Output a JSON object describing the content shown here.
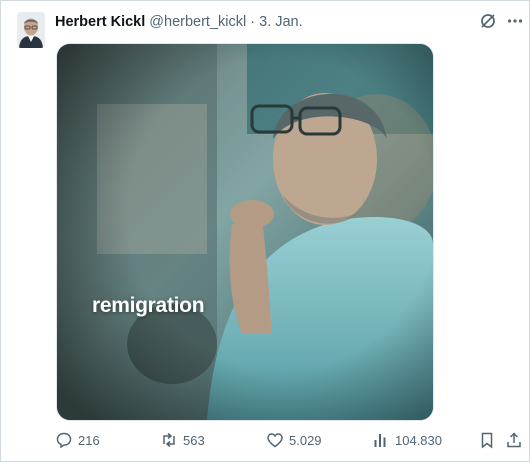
{
  "tweet": {
    "author_name": "Herbert Kickl",
    "handle": "@herbert_kickl",
    "separator": "·",
    "date": "3. Jan.",
    "image_overlay_text": "remigration"
  },
  "actions": {
    "replies": "216",
    "reposts": "563",
    "likes": "5.029",
    "views": "104.830"
  },
  "icons": {
    "avatar": "author-avatar",
    "grok": "grok-icon",
    "more": "more-icon",
    "reply": "reply-icon",
    "repost": "repost-icon",
    "like": "like-icon",
    "views": "views-icon",
    "bookmark": "bookmark-icon",
    "share": "share-icon"
  },
  "colors": {
    "text_primary": "#0f1419",
    "text_secondary": "#536471",
    "border": "#cfd9de",
    "image_teal": "#3f8d96"
  }
}
